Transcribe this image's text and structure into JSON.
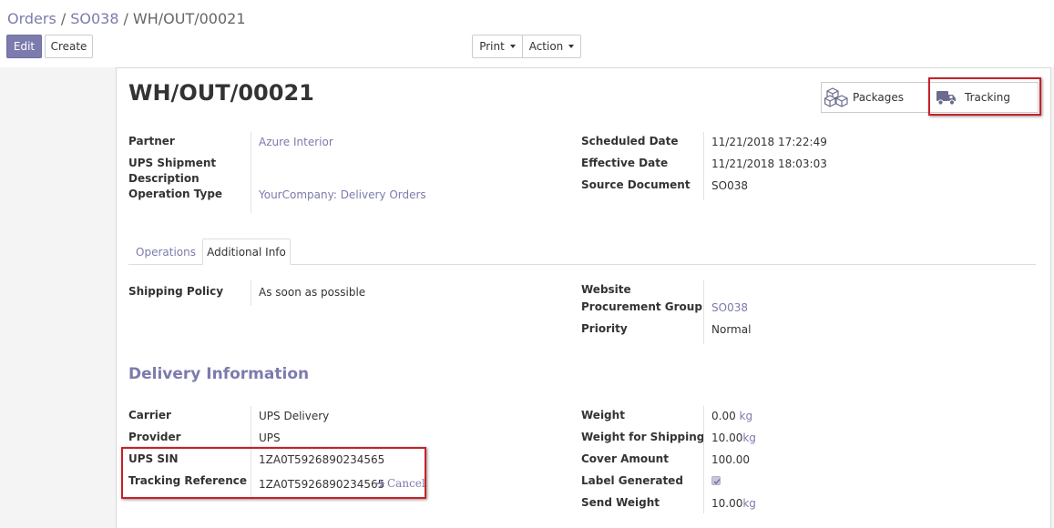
{
  "breadcrumb": {
    "items": [
      "Orders",
      "SO038"
    ],
    "current": "WH/OUT/00021"
  },
  "toolbar": {
    "edit_label": "Edit",
    "create_label": "Create",
    "print_label": "Print",
    "action_label": "Action"
  },
  "record": {
    "title": "WH/OUT/00021"
  },
  "smart_buttons": {
    "packages_label": "Packages",
    "tracking_label": "Tracking"
  },
  "header_fields": {
    "left": [
      {
        "label": "Partner",
        "value": "Azure Interior"
      },
      {
        "label": "UPS Shipment Description",
        "value": ""
      },
      {
        "label": "Operation Type",
        "value": "YourCompany: Delivery Orders"
      }
    ],
    "right": [
      {
        "label": "Scheduled Date",
        "value": "11/21/2018 17:22:49"
      },
      {
        "label": "Effective Date",
        "value": "11/21/2018 18:03:03"
      },
      {
        "label": "Source Document",
        "value": "SO038"
      }
    ],
    "ups_label_line1": "UPS Shipment",
    "ups_label_line2": "Description"
  },
  "tabs": [
    {
      "label": "Operations",
      "active": false
    },
    {
      "label": "Additional Info",
      "active": true
    }
  ],
  "additional_info": {
    "left": [
      {
        "label": "Shipping Policy",
        "value": "As soon as possible"
      }
    ],
    "right": [
      {
        "label": "Website",
        "value": ""
      },
      {
        "label": "Procurement Group",
        "value": "SO038"
      },
      {
        "label": "Priority",
        "value": "Normal"
      }
    ]
  },
  "delivery": {
    "section_title": "Delivery Information",
    "left": [
      {
        "label": "Carrier",
        "value": "UPS Delivery"
      },
      {
        "label": "Provider",
        "value": "UPS"
      },
      {
        "label": "UPS SIN",
        "value": "1ZA0T5926890234565"
      },
      {
        "label": "Tracking Reference",
        "value": "1ZA0T5926890234565"
      }
    ],
    "cancel_label": "Cancel",
    "right": [
      {
        "label": "Weight",
        "value": "0.00",
        "unit": "kg"
      },
      {
        "label": "Weight for Shipping",
        "value": "10.00",
        "unit": "kg"
      },
      {
        "label": "Cover Amount",
        "value": "100.00"
      },
      {
        "label": "Label Generated",
        "checked": true
      },
      {
        "label": "Send Weight",
        "value": "10.00",
        "unit": "kg"
      }
    ]
  },
  "colors": {
    "accent": "#7c7bad",
    "highlight_box": "#c9202a"
  },
  "icons": {
    "packages": "cubes-icon",
    "tracking": "truck-icon",
    "cancel": "arrow-right-icon",
    "label_generated": "check-icon"
  }
}
